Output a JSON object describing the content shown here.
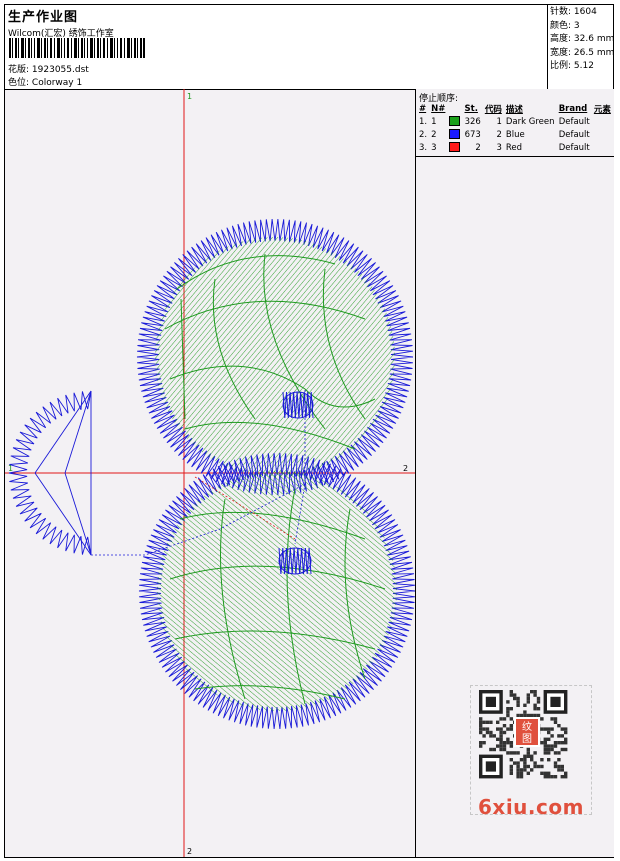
{
  "header": {
    "title": "生产作业图",
    "company": "Wilcom(汇宏) 绣饰工作室",
    "design_label": "花版:",
    "design_value": "1923055.dst",
    "colorway_label": "色位:",
    "colorway_value": "Colorway 1"
  },
  "stats": [
    {
      "label": "针数:",
      "value": "1604"
    },
    {
      "label": "颜色:",
      "value": "3"
    },
    {
      "label": "高度:",
      "value": "32.6 mm"
    },
    {
      "label": "宽度:",
      "value": "26.5 mm"
    },
    {
      "label": "比例:",
      "value": "5.12"
    }
  ],
  "stop_sequence": {
    "title": "停止顺序:",
    "columns": [
      "#",
      "N#",
      "St.",
      "代码",
      "描述",
      "Brand",
      "元素"
    ],
    "rows": [
      {
        "idx": "1.",
        "n": "1",
        "swatch": "#1aa01a",
        "st": "326",
        "code": "1",
        "desc": "Dark Green",
        "brand": "Default"
      },
      {
        "idx": "2.",
        "n": "2",
        "swatch": "#1a1aff",
        "st": "673",
        "code": "2",
        "desc": "Blue",
        "brand": "Default"
      },
      {
        "idx": "3.",
        "n": "3",
        "swatch": "#ff1a1a",
        "st": "2",
        "code": "3",
        "desc": "Red",
        "brand": "Default"
      }
    ]
  },
  "axis_labels": {
    "top": "1",
    "bottom": "2",
    "left": "1",
    "right": "2"
  },
  "colors": {
    "green": "#1f9a1f",
    "blue": "#1a1ad8",
    "red": "#e01818",
    "background": "#f3f1f4"
  },
  "watermark": {
    "text": "6xiu.com",
    "badge_top": "纹",
    "badge_bottom": "图"
  }
}
